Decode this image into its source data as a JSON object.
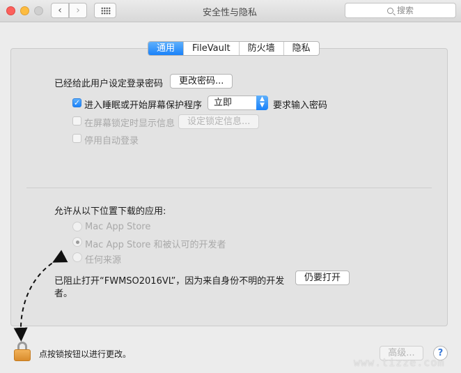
{
  "window": {
    "title": "安全性与隐私"
  },
  "search": {
    "placeholder": "搜索"
  },
  "nav": {
    "back": "‹",
    "forward": "›"
  },
  "tabs": [
    {
      "label": "通用",
      "active": true
    },
    {
      "label": "FileVault",
      "active": false
    },
    {
      "label": "防火墙",
      "active": false
    },
    {
      "label": "隐私",
      "active": false
    }
  ],
  "login": {
    "password_label": "已经给此用户设定登录密码",
    "change_password_button": "更改密码...",
    "sleep_checkbox_label": "进入睡眠或开始屏幕保护程序",
    "sleep_checked": true,
    "sleep_select_value": "立即",
    "require_password_label": "要求输入密码",
    "lock_message_label": "在屏幕锁定时显示信息",
    "set_lock_message_button": "设定锁定信息...",
    "disable_autologin_label": "停用自动登录"
  },
  "downloads": {
    "heading": "允许从以下位置下载的应用:",
    "options": [
      {
        "label": "Mac App Store",
        "selected": false
      },
      {
        "label": "Mac App Store 和被认可的开发者",
        "selected": true
      },
      {
        "label": "任何来源",
        "selected": false
      }
    ],
    "blocked_line1": "已阻止打开“FWMSO2016VL”，因为来自身份不明的开发",
    "blocked_line2": "者。",
    "open_anyway_button": "仍要打开"
  },
  "footer": {
    "lock_text": "点按锁按钮以进行更改。",
    "advanced_button": "高级...",
    "help": "?"
  },
  "watermark": "www.tizze.com",
  "colors": {
    "accent": "#1a82fa",
    "close": "#fc605c",
    "minimize": "#fdbc40"
  }
}
